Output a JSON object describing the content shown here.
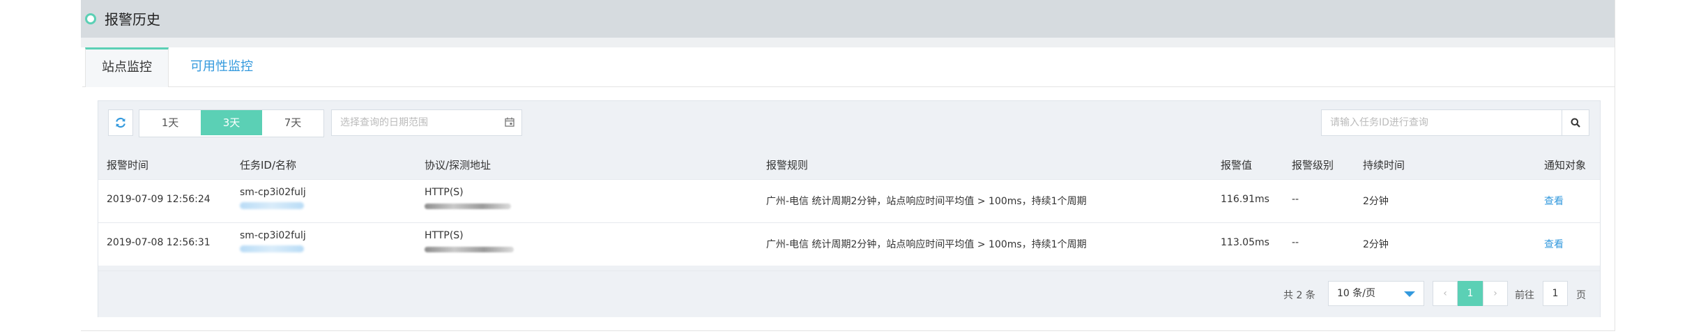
{
  "header": {
    "title": "报警历史"
  },
  "tabs": [
    {
      "label": "站点监控",
      "active": true
    },
    {
      "label": "可用性监控",
      "active": false
    }
  ],
  "toolbar": {
    "range_buttons": [
      {
        "label": "1天",
        "active": false
      },
      {
        "label": "3天",
        "active": true
      },
      {
        "label": "7天",
        "active": false
      }
    ],
    "date_placeholder": "选择查询的日期范围",
    "search_placeholder": "请输入任务ID进行查询"
  },
  "table": {
    "columns": [
      "报警时间",
      "任务ID/名称",
      "协议/探测地址",
      "报警规则",
      "报警值",
      "报警级别",
      "持续时间",
      "通知对象"
    ],
    "rows": [
      {
        "time": "2019-07-09 12:56:24",
        "task_id": "sm-cp3i02fulj",
        "protocol": "HTTP(S)",
        "rule": "广州-电信 统计周期2分钟，站点响应时间平均值 > 100ms，持续1个周期",
        "value": "116.91ms",
        "level": "--",
        "duration": "2分钟",
        "notify": "查看"
      },
      {
        "time": "2019-07-08 12:56:31",
        "task_id": "sm-cp3i02fulj",
        "protocol": "HTTP(S)",
        "rule": "广州-电信 统计周期2分钟，站点响应时间平均值 > 100ms，持续1个周期",
        "value": "113.05ms",
        "level": "--",
        "duration": "2分钟",
        "notify": "查看"
      }
    ]
  },
  "pagination": {
    "total": "共 2 条",
    "page_size": "10 条/页",
    "current_page": "1",
    "goto_label": "前往",
    "goto_value": "1",
    "page_label": "页"
  },
  "colors": {
    "accent": "#5bd0b5",
    "link": "#3399dd",
    "header_bg": "#d6dbdf"
  }
}
